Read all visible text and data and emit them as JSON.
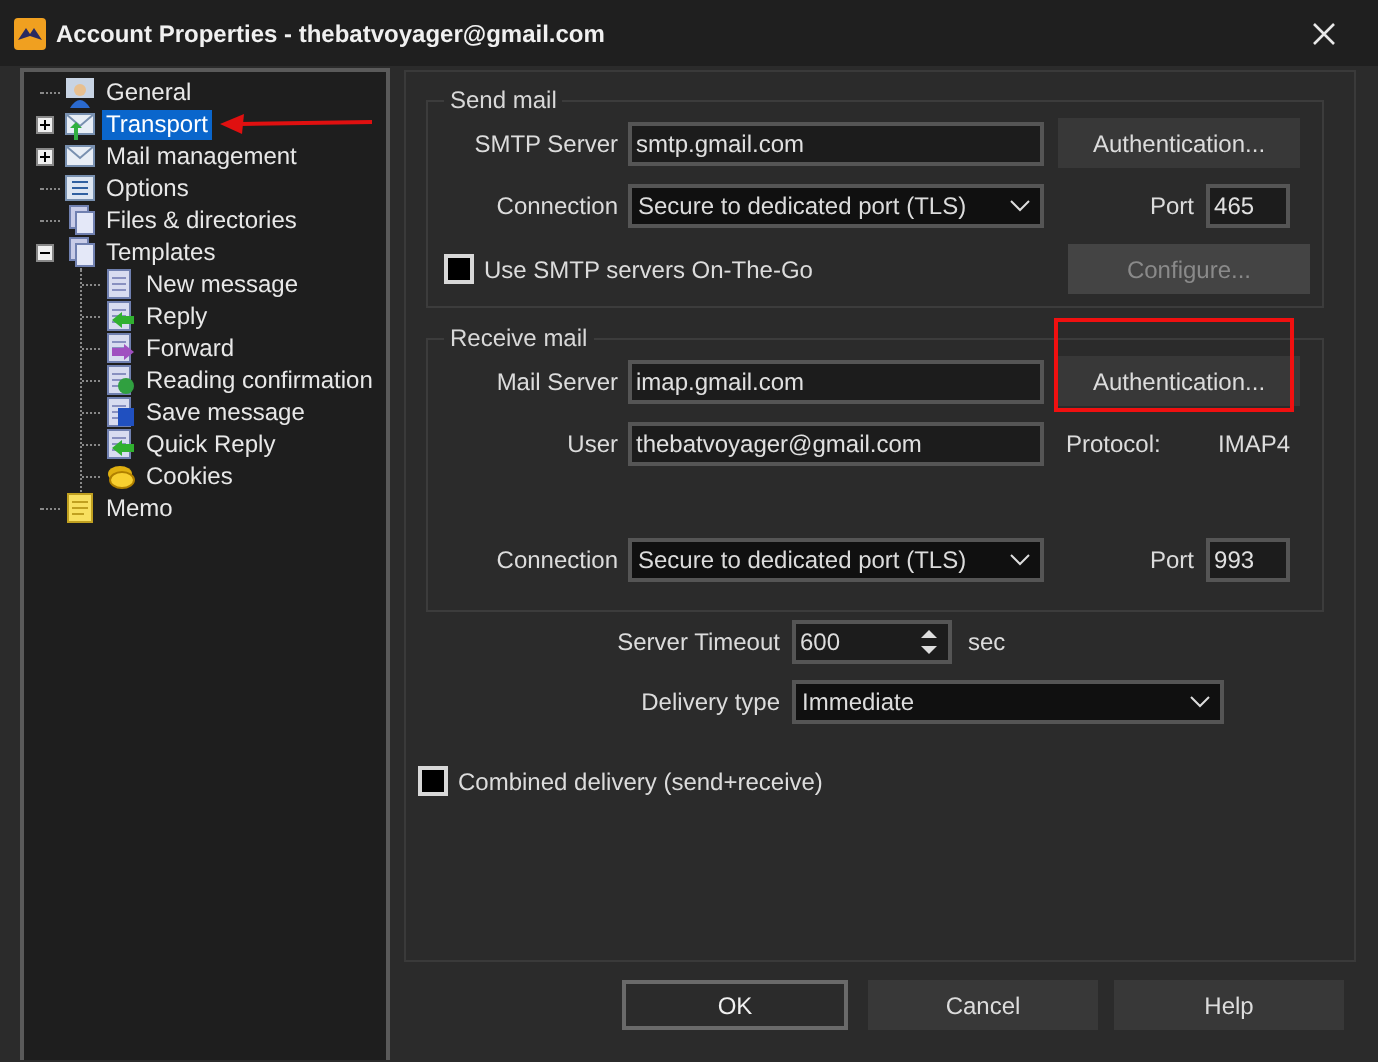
{
  "window": {
    "title": "Account Properties - thebatvoyager@gmail.com"
  },
  "tree": [
    {
      "label": "General",
      "selected": false,
      "pointed": false,
      "expandable": false
    },
    {
      "label": "Transport",
      "selected": true,
      "pointed": true,
      "expandable": true,
      "expanded": false
    },
    {
      "label": "Mail management",
      "selected": false,
      "pointed": false,
      "expandable": true,
      "expanded": false
    },
    {
      "label": "Options",
      "selected": false,
      "pointed": false,
      "expandable": false
    },
    {
      "label": "Files & directories",
      "selected": false,
      "pointed": false,
      "expandable": false
    },
    {
      "label": "Templates",
      "selected": false,
      "pointed": false,
      "expandable": true,
      "expanded": true,
      "children": [
        {
          "label": "New message",
          "selected": false,
          "pointed": false
        },
        {
          "label": "Reply",
          "selected": false,
          "pointed": false
        },
        {
          "label": "Forward",
          "selected": false,
          "pointed": false
        },
        {
          "label": "Reading confirmation",
          "selected": false,
          "pointed": false
        },
        {
          "label": "Save message",
          "selected": false,
          "pointed": false
        },
        {
          "label": "Quick Reply",
          "selected": false,
          "pointed": false
        },
        {
          "label": "Cookies",
          "selected": false,
          "pointed": false
        }
      ]
    },
    {
      "label": "Memo",
      "selected": false,
      "pointed": false,
      "expandable": false
    }
  ],
  "send_mail": {
    "title": "Send mail",
    "server": {
      "label": "SMTP Server",
      "value": "smtp.gmail.com"
    },
    "auth_button": {
      "label": "Authentication...",
      "highlighted": false
    },
    "connection": {
      "label": "Connection",
      "value": "Secure to dedicated port (TLS)"
    },
    "port": {
      "label": "Port",
      "value": "465"
    },
    "on_the_go": {
      "label": "Use SMTP servers On-The-Go",
      "checked": false
    },
    "configure_button": {
      "label": "Configure...",
      "disabled": true
    }
  },
  "receive_mail": {
    "title": "Receive mail",
    "server": {
      "label": "Mail Server",
      "value": "imap.gmail.com"
    },
    "auth_button": {
      "label": "Authentication...",
      "highlighted": true
    },
    "user": {
      "label": "User",
      "value": "thebatvoyager@gmail.com"
    },
    "protocol": {
      "label": "Protocol:",
      "value": "IMAP4"
    },
    "connection": {
      "label": "Connection",
      "value": "Secure to dedicated port (TLS)"
    },
    "port": {
      "label": "Port",
      "value": "993"
    }
  },
  "timeout": {
    "label": "Server Timeout",
    "value": "600",
    "unit": "sec"
  },
  "delivery_type": {
    "label": "Delivery type",
    "value": "Immediate"
  },
  "combined": {
    "label": "Combined delivery (send+receive)",
    "checked": false
  },
  "buttons": [
    {
      "label": "OK",
      "default": true
    },
    {
      "label": "Cancel",
      "default": false
    },
    {
      "label": "Help",
      "default": false
    }
  ]
}
